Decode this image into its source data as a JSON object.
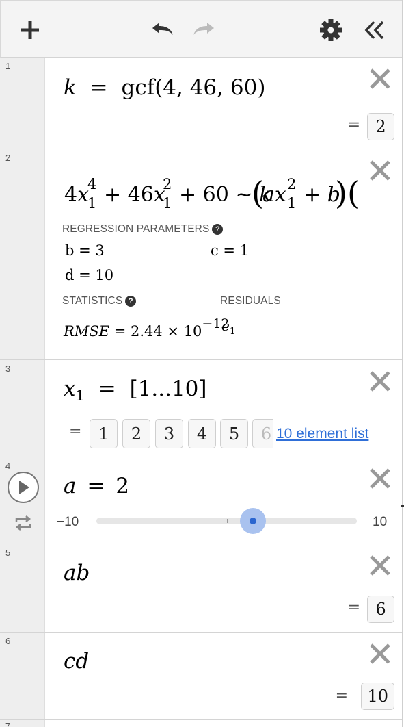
{
  "toolbar": {
    "add_icon": "plus-icon",
    "undo_icon": "undo-icon",
    "redo_icon": "redo-icon",
    "settings_icon": "gear-icon",
    "collapse_icon": "double-chevron-left-icon"
  },
  "expressions": [
    {
      "index": "1",
      "lhs": "k",
      "eq": "=",
      "fn": "gcf",
      "args": "(4, 46, 60)",
      "result_eq": "=",
      "result": "2"
    },
    {
      "index": "2",
      "regression": {
        "regression_params_heading": "REGRESSION PARAMETERS",
        "param_b": "b = 3",
        "param_c": "c = 1",
        "param_d": "d = 10",
        "statistics_heading": "STATISTICS",
        "residuals_heading": "RESIDUALS",
        "rmse_label": "RMSE",
        "rmse_eq": "= 2.44 × 10",
        "rmse_exp": "−12",
        "residual_var": "e",
        "residual_sub": "1"
      }
    },
    {
      "index": "3",
      "lhs": "x",
      "lhs_sub": "1",
      "eq": "=",
      "rhs": "[1...10]",
      "list_eq": "=",
      "list_values": [
        "1",
        "2",
        "3",
        "4",
        "5",
        "6"
      ],
      "list_summary": "10 element list"
    },
    {
      "index": "4",
      "lhs": "a",
      "eq": "=",
      "value": "2",
      "slider_min": "−10",
      "slider_max": "10",
      "slider_fraction": 0.6,
      "play_icon": "play-icon",
      "loop_icon": "loop-icon"
    },
    {
      "index": "5",
      "expr": "ab",
      "result_eq": "=",
      "result": "6"
    },
    {
      "index": "6",
      "expr": "cd",
      "result_eq": "=",
      "result": "10"
    },
    {
      "index": "7"
    }
  ],
  "colors": {
    "accent": "#2b66cf",
    "link": "#2f6fd8",
    "gutter": "#eeeeee",
    "toolbar": "#f4f4f4"
  }
}
